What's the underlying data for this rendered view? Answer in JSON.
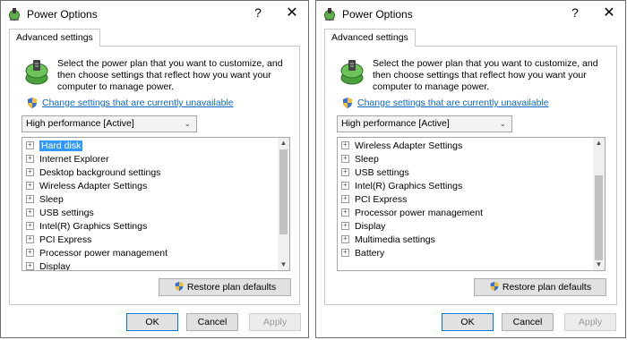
{
  "colors": {
    "link": "#0b66c5",
    "selection": "#3399ff",
    "dialog_border": "#6b6b6b"
  },
  "dialogs": [
    {
      "title": "Power Options",
      "help_icon": "?",
      "close_icon": "✕",
      "tab": "Advanced settings",
      "intro": "Select the power plan that you want to customize, and then choose settings that reflect how you want your computer to manage power.",
      "link": "Change settings that are currently unavailable",
      "plan_select": "High performance [Active]",
      "tree_items": [
        {
          "label": "Hard disk",
          "selected": true
        },
        {
          "label": "Internet Explorer"
        },
        {
          "label": "Desktop background settings"
        },
        {
          "label": "Wireless Adapter Settings"
        },
        {
          "label": "Sleep"
        },
        {
          "label": "USB settings"
        },
        {
          "label": "Intel(R) Graphics Settings"
        },
        {
          "label": "PCI Express"
        },
        {
          "label": "Processor power management"
        },
        {
          "label": "Display"
        }
      ],
      "scroll_position": 0.0,
      "restore_button": "Restore plan defaults",
      "ok": "OK",
      "cancel": "Cancel",
      "apply": "Apply"
    },
    {
      "title": "Power Options",
      "help_icon": "?",
      "close_icon": "✕",
      "tab": "Advanced settings",
      "intro": "Select the power plan that you want to customize, and then choose settings that reflect how you want your computer to manage power.",
      "link": "Change settings that are currently unavailable",
      "plan_select": "High performance [Active]",
      "tree_items": [
        {
          "label": "Wireless Adapter Settings"
        },
        {
          "label": "Sleep"
        },
        {
          "label": "USB settings"
        },
        {
          "label": "Intel(R) Graphics Settings"
        },
        {
          "label": "PCI Express"
        },
        {
          "label": "Processor power management"
        },
        {
          "label": "Display"
        },
        {
          "label": "Multimedia settings"
        },
        {
          "label": "Battery"
        }
      ],
      "scroll_position": 1.0,
      "restore_button": "Restore plan defaults",
      "ok": "OK",
      "cancel": "Cancel",
      "apply": "Apply"
    }
  ]
}
